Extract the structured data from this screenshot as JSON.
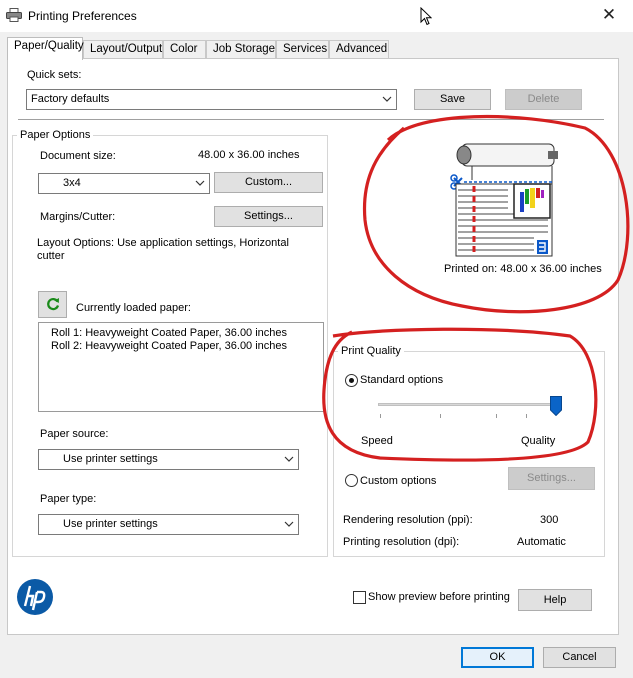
{
  "window": {
    "title": "Printing Preferences"
  },
  "tabs": [
    {
      "label": "Paper/Quality",
      "active": true
    },
    {
      "label": "Layout/Output"
    },
    {
      "label": "Color"
    },
    {
      "label": "Job Storage"
    },
    {
      "label": "Services"
    },
    {
      "label": "Advanced"
    }
  ],
  "quick_sets": {
    "label": "Quick sets:",
    "selected": "Factory defaults",
    "save_label": "Save",
    "delete_label": "Delete"
  },
  "paper_options": {
    "title": "Paper Options",
    "document_size_label": "Document size:",
    "document_size_value": "48.00 x 36.00 inches",
    "size_selected": "3x4",
    "custom_label": "Custom...",
    "margins_label": "Margins/Cutter:",
    "settings_label": "Settings...",
    "layout_options_text": "Layout Options: Use application settings, Horizontal cutter",
    "currently_loaded_label": "Currently loaded paper:",
    "loaded_papers": [
      "Roll 1: Heavyweight Coated Paper, 36.00 inches",
      "Roll 2: Heavyweight Coated Paper, 36.00 inches"
    ],
    "paper_source_label": "Paper source:",
    "paper_source_selected": "Use printer settings",
    "paper_type_label": "Paper type:",
    "paper_type_selected": "Use printer settings"
  },
  "preview": {
    "printed_on": "Printed on: 48.00 x 36.00 inches"
  },
  "print_quality": {
    "title": "Print Quality",
    "standard_label": "Standard options",
    "standard_checked": true,
    "slider_level": 1.0,
    "speed_label": "Speed",
    "quality_label": "Quality",
    "custom_label": "Custom options",
    "custom_checked": false,
    "settings_label": "Settings...",
    "rendering_label": "Rendering resolution (ppi):",
    "rendering_value": "300",
    "printing_label": "Printing resolution (dpi):",
    "printing_value": "Automatic"
  },
  "footer": {
    "show_preview_label": "Show preview before printing",
    "help_label": "Help",
    "ok_label": "OK",
    "cancel_label": "Cancel"
  },
  "colors": {
    "accent": "#0078d7",
    "annotation": "#d42020",
    "hp_blue": "#0b5aa6",
    "slider_thumb": "#0a64c8"
  }
}
